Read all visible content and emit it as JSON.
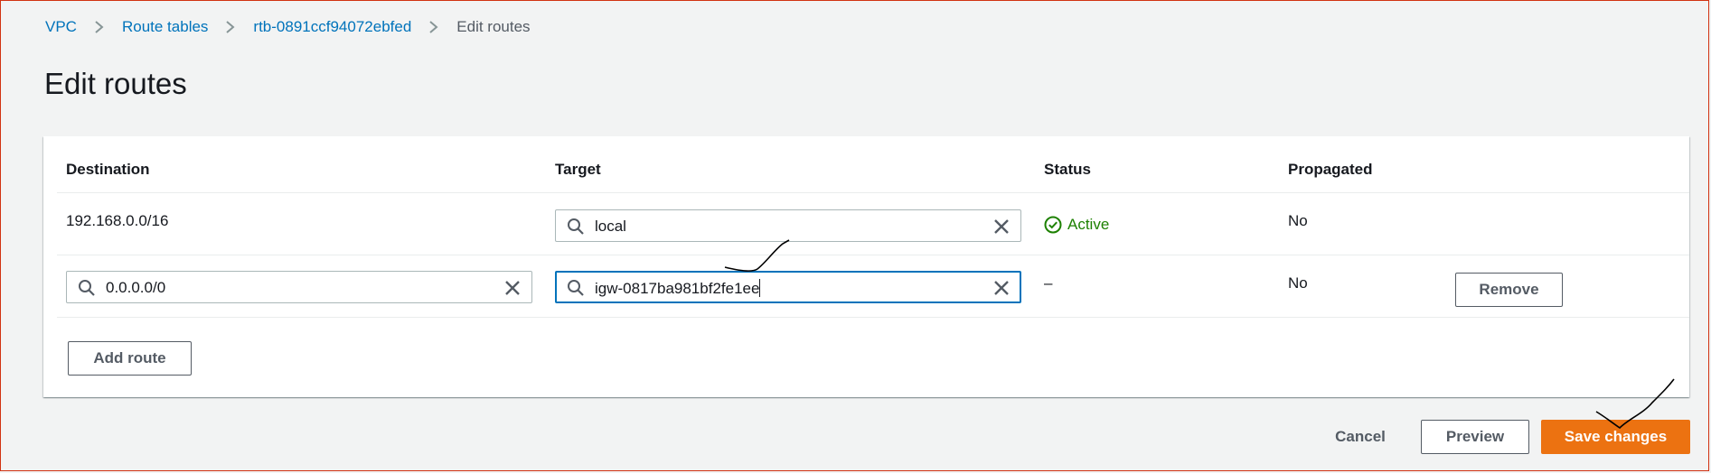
{
  "breadcrumb": {
    "items": [
      "VPC",
      "Route tables",
      "rtb-0891ccf94072ebfed"
    ],
    "current": "Edit routes"
  },
  "page": {
    "title": "Edit routes"
  },
  "table": {
    "columns": {
      "destination": "Destination",
      "target": "Target",
      "status": "Status",
      "propagated": "Propagated"
    },
    "rows": [
      {
        "destination": "192.168.0.0/16",
        "target": "local",
        "status": "Active",
        "propagated": "No"
      },
      {
        "destination": "0.0.0.0/0",
        "target": "igw-0817ba981bf2fe1ee",
        "status": "–",
        "propagated": "No",
        "remove_label": "Remove"
      }
    ]
  },
  "actions": {
    "add_route": "Add route",
    "cancel": "Cancel",
    "preview": "Preview",
    "save": "Save changes"
  },
  "colors": {
    "link": "#0073bb",
    "primary": "#ec7211",
    "success": "#1d8102",
    "focus": "#0073bb"
  },
  "icons": [
    "chevron-right-icon",
    "search-icon",
    "clear-icon",
    "status-success-icon"
  ]
}
